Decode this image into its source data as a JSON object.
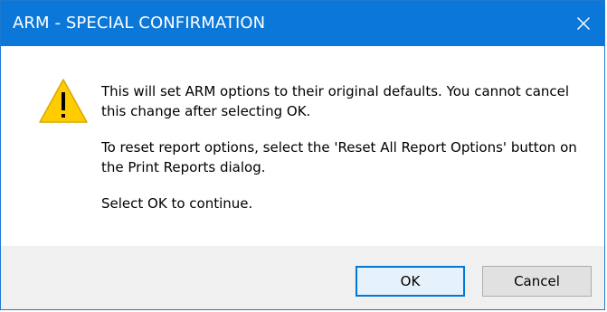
{
  "window": {
    "title": "ARM - SPECIAL CONFIRMATION",
    "close_icon": "close-icon"
  },
  "dialog": {
    "icon": "warning-icon",
    "message_lines": [
      "This will set ARM options to their original defaults. You cannot cancel this change after selecting OK.",
      "To reset report options, select the 'Reset All Report Options' button on the Print Reports dialog.",
      "Select OK to continue."
    ]
  },
  "buttons": {
    "ok_label": "OK",
    "cancel_label": "Cancel"
  },
  "colors": {
    "titlebar": "#0b78d9",
    "warning_fill": "#ffcc00",
    "accent": "#0078d7"
  }
}
